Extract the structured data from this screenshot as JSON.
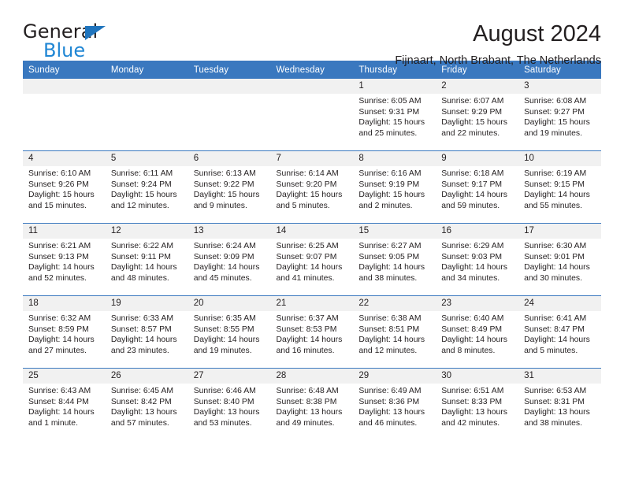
{
  "logo": {
    "word_top": "General",
    "word_bottom": "Blue",
    "triangle_icon": "triangle-icon",
    "color_dark": "#231f20",
    "color_blue": "#1f86d4"
  },
  "header": {
    "title": "August 2024",
    "subtitle": "Fijnaart, North Brabant, The Netherlands"
  },
  "theme": {
    "header_blue": "#3a78bf",
    "band_gray": "#f1f1f1",
    "text": "#231f20"
  },
  "calendar": {
    "weekday_headers": [
      "Sunday",
      "Monday",
      "Tuesday",
      "Wednesday",
      "Thursday",
      "Friday",
      "Saturday"
    ],
    "weeks": [
      [
        {
          "day": "",
          "empty": true,
          "sunrise": "",
          "sunset": "",
          "daylight1": "",
          "daylight2": ""
        },
        {
          "day": "",
          "empty": true,
          "sunrise": "",
          "sunset": "",
          "daylight1": "",
          "daylight2": ""
        },
        {
          "day": "",
          "empty": true,
          "sunrise": "",
          "sunset": "",
          "daylight1": "",
          "daylight2": ""
        },
        {
          "day": "",
          "empty": true,
          "sunrise": "",
          "sunset": "",
          "daylight1": "",
          "daylight2": ""
        },
        {
          "day": "1",
          "empty": false,
          "sunrise": "Sunrise: 6:05 AM",
          "sunset": "Sunset: 9:31 PM",
          "daylight1": "Daylight: 15 hours",
          "daylight2": "and 25 minutes."
        },
        {
          "day": "2",
          "empty": false,
          "sunrise": "Sunrise: 6:07 AM",
          "sunset": "Sunset: 9:29 PM",
          "daylight1": "Daylight: 15 hours",
          "daylight2": "and 22 minutes."
        },
        {
          "day": "3",
          "empty": false,
          "sunrise": "Sunrise: 6:08 AM",
          "sunset": "Sunset: 9:27 PM",
          "daylight1": "Daylight: 15 hours",
          "daylight2": "and 19 minutes."
        }
      ],
      [
        {
          "day": "4",
          "empty": false,
          "sunrise": "Sunrise: 6:10 AM",
          "sunset": "Sunset: 9:26 PM",
          "daylight1": "Daylight: 15 hours",
          "daylight2": "and 15 minutes."
        },
        {
          "day": "5",
          "empty": false,
          "sunrise": "Sunrise: 6:11 AM",
          "sunset": "Sunset: 9:24 PM",
          "daylight1": "Daylight: 15 hours",
          "daylight2": "and 12 minutes."
        },
        {
          "day": "6",
          "empty": false,
          "sunrise": "Sunrise: 6:13 AM",
          "sunset": "Sunset: 9:22 PM",
          "daylight1": "Daylight: 15 hours",
          "daylight2": "and 9 minutes."
        },
        {
          "day": "7",
          "empty": false,
          "sunrise": "Sunrise: 6:14 AM",
          "sunset": "Sunset: 9:20 PM",
          "daylight1": "Daylight: 15 hours",
          "daylight2": "and 5 minutes."
        },
        {
          "day": "8",
          "empty": false,
          "sunrise": "Sunrise: 6:16 AM",
          "sunset": "Sunset: 9:19 PM",
          "daylight1": "Daylight: 15 hours",
          "daylight2": "and 2 minutes."
        },
        {
          "day": "9",
          "empty": false,
          "sunrise": "Sunrise: 6:18 AM",
          "sunset": "Sunset: 9:17 PM",
          "daylight1": "Daylight: 14 hours",
          "daylight2": "and 59 minutes."
        },
        {
          "day": "10",
          "empty": false,
          "sunrise": "Sunrise: 6:19 AM",
          "sunset": "Sunset: 9:15 PM",
          "daylight1": "Daylight: 14 hours",
          "daylight2": "and 55 minutes."
        }
      ],
      [
        {
          "day": "11",
          "empty": false,
          "sunrise": "Sunrise: 6:21 AM",
          "sunset": "Sunset: 9:13 PM",
          "daylight1": "Daylight: 14 hours",
          "daylight2": "and 52 minutes."
        },
        {
          "day": "12",
          "empty": false,
          "sunrise": "Sunrise: 6:22 AM",
          "sunset": "Sunset: 9:11 PM",
          "daylight1": "Daylight: 14 hours",
          "daylight2": "and 48 minutes."
        },
        {
          "day": "13",
          "empty": false,
          "sunrise": "Sunrise: 6:24 AM",
          "sunset": "Sunset: 9:09 PM",
          "daylight1": "Daylight: 14 hours",
          "daylight2": "and 45 minutes."
        },
        {
          "day": "14",
          "empty": false,
          "sunrise": "Sunrise: 6:25 AM",
          "sunset": "Sunset: 9:07 PM",
          "daylight1": "Daylight: 14 hours",
          "daylight2": "and 41 minutes."
        },
        {
          "day": "15",
          "empty": false,
          "sunrise": "Sunrise: 6:27 AM",
          "sunset": "Sunset: 9:05 PM",
          "daylight1": "Daylight: 14 hours",
          "daylight2": "and 38 minutes."
        },
        {
          "day": "16",
          "empty": false,
          "sunrise": "Sunrise: 6:29 AM",
          "sunset": "Sunset: 9:03 PM",
          "daylight1": "Daylight: 14 hours",
          "daylight2": "and 34 minutes."
        },
        {
          "day": "17",
          "empty": false,
          "sunrise": "Sunrise: 6:30 AM",
          "sunset": "Sunset: 9:01 PM",
          "daylight1": "Daylight: 14 hours",
          "daylight2": "and 30 minutes."
        }
      ],
      [
        {
          "day": "18",
          "empty": false,
          "sunrise": "Sunrise: 6:32 AM",
          "sunset": "Sunset: 8:59 PM",
          "daylight1": "Daylight: 14 hours",
          "daylight2": "and 27 minutes."
        },
        {
          "day": "19",
          "empty": false,
          "sunrise": "Sunrise: 6:33 AM",
          "sunset": "Sunset: 8:57 PM",
          "daylight1": "Daylight: 14 hours",
          "daylight2": "and 23 minutes."
        },
        {
          "day": "20",
          "empty": false,
          "sunrise": "Sunrise: 6:35 AM",
          "sunset": "Sunset: 8:55 PM",
          "daylight1": "Daylight: 14 hours",
          "daylight2": "and 19 minutes."
        },
        {
          "day": "21",
          "empty": false,
          "sunrise": "Sunrise: 6:37 AM",
          "sunset": "Sunset: 8:53 PM",
          "daylight1": "Daylight: 14 hours",
          "daylight2": "and 16 minutes."
        },
        {
          "day": "22",
          "empty": false,
          "sunrise": "Sunrise: 6:38 AM",
          "sunset": "Sunset: 8:51 PM",
          "daylight1": "Daylight: 14 hours",
          "daylight2": "and 12 minutes."
        },
        {
          "day": "23",
          "empty": false,
          "sunrise": "Sunrise: 6:40 AM",
          "sunset": "Sunset: 8:49 PM",
          "daylight1": "Daylight: 14 hours",
          "daylight2": "and 8 minutes."
        },
        {
          "day": "24",
          "empty": false,
          "sunrise": "Sunrise: 6:41 AM",
          "sunset": "Sunset: 8:47 PM",
          "daylight1": "Daylight: 14 hours",
          "daylight2": "and 5 minutes."
        }
      ],
      [
        {
          "day": "25",
          "empty": false,
          "sunrise": "Sunrise: 6:43 AM",
          "sunset": "Sunset: 8:44 PM",
          "daylight1": "Daylight: 14 hours",
          "daylight2": "and 1 minute."
        },
        {
          "day": "26",
          "empty": false,
          "sunrise": "Sunrise: 6:45 AM",
          "sunset": "Sunset: 8:42 PM",
          "daylight1": "Daylight: 13 hours",
          "daylight2": "and 57 minutes."
        },
        {
          "day": "27",
          "empty": false,
          "sunrise": "Sunrise: 6:46 AM",
          "sunset": "Sunset: 8:40 PM",
          "daylight1": "Daylight: 13 hours",
          "daylight2": "and 53 minutes."
        },
        {
          "day": "28",
          "empty": false,
          "sunrise": "Sunrise: 6:48 AM",
          "sunset": "Sunset: 8:38 PM",
          "daylight1": "Daylight: 13 hours",
          "daylight2": "and 49 minutes."
        },
        {
          "day": "29",
          "empty": false,
          "sunrise": "Sunrise: 6:49 AM",
          "sunset": "Sunset: 8:36 PM",
          "daylight1": "Daylight: 13 hours",
          "daylight2": "and 46 minutes."
        },
        {
          "day": "30",
          "empty": false,
          "sunrise": "Sunrise: 6:51 AM",
          "sunset": "Sunset: 8:33 PM",
          "daylight1": "Daylight: 13 hours",
          "daylight2": "and 42 minutes."
        },
        {
          "day": "31",
          "empty": false,
          "sunrise": "Sunrise: 6:53 AM",
          "sunset": "Sunset: 8:31 PM",
          "daylight1": "Daylight: 13 hours",
          "daylight2": "and 38 minutes."
        }
      ]
    ]
  }
}
